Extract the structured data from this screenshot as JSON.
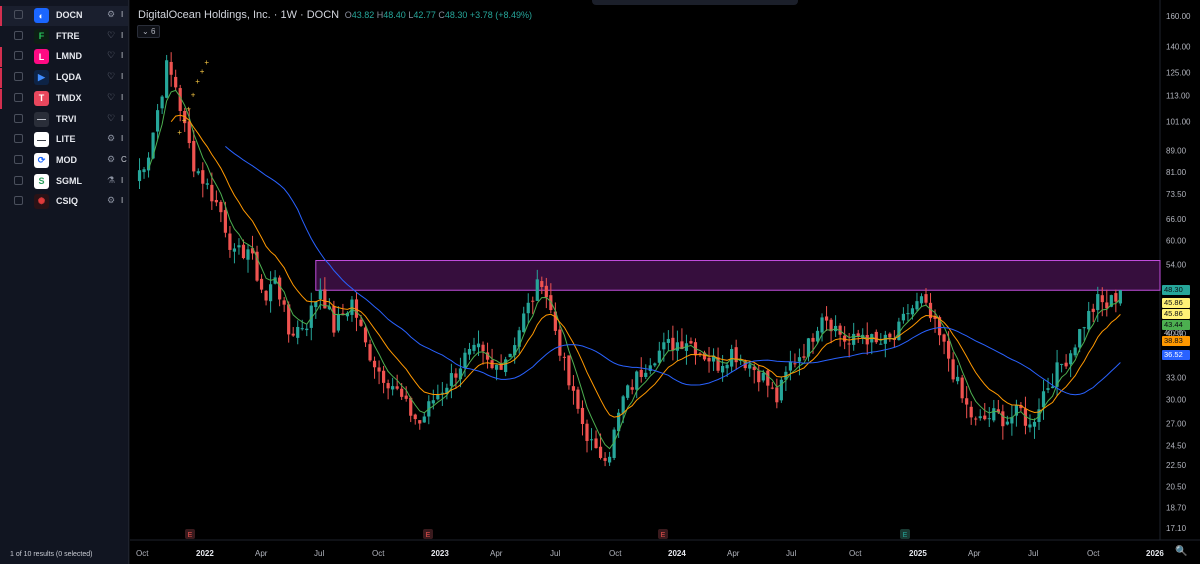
{
  "watchlist": {
    "items": [
      {
        "symbol": "DOCN",
        "flag": "#d32f4f",
        "logo_bg": "#1a66ff",
        "logo_glyph": "◐",
        "logo_color": "#ffffff",
        "action_icon": "settings-icon",
        "trunc": "I"
      },
      {
        "symbol": "FTRE",
        "flag": "",
        "logo_bg": "#0d1f14",
        "logo_glyph": "F",
        "logo_color": "#27c65d",
        "action_icon": "heart-icon",
        "trunc": "I"
      },
      {
        "symbol": "LMND",
        "flag": "#d32f4f",
        "logo_bg": "#ff0a83",
        "logo_glyph": "L",
        "logo_color": "#ffffff",
        "action_icon": "heart-icon",
        "trunc": "I"
      },
      {
        "symbol": "LQDA",
        "flag": "#d32f4f",
        "logo_bg": "#0d2345",
        "logo_glyph": "▶",
        "logo_color": "#3f8cff",
        "action_icon": "heart-icon",
        "trunc": "I"
      },
      {
        "symbol": "TMDX",
        "flag": "#d32f4f",
        "logo_bg": "#e8475d",
        "logo_glyph": "T",
        "logo_color": "#ffffff",
        "action_icon": "heart-icon",
        "trunc": "I"
      },
      {
        "symbol": "TRVI",
        "flag": "",
        "logo_bg": "#2a2e39",
        "logo_glyph": "—",
        "logo_color": "#c9ccd4",
        "action_icon": "heart-icon",
        "trunc": "I"
      },
      {
        "symbol": "LITE",
        "flag": "",
        "logo_bg": "#ffffff",
        "logo_glyph": "—",
        "logo_color": "#2a2e39",
        "action_icon": "settings-icon",
        "trunc": "I"
      },
      {
        "symbol": "MOD",
        "flag": "",
        "logo_bg": "#ffffff",
        "logo_glyph": "⟳",
        "logo_color": "#1a66ff",
        "action_icon": "settings-icon",
        "trunc": "C"
      },
      {
        "symbol": "SGML",
        "flag": "",
        "logo_bg": "#ffffff",
        "logo_glyph": "S",
        "logo_color": "#2a9d5a",
        "action_icon": "flask-icon",
        "trunc": "I"
      },
      {
        "symbol": "CSIQ",
        "flag": "",
        "logo_bg": "#2a1216",
        "logo_glyph": "✺",
        "logo_color": "#e03b3b",
        "action_icon": "settings-icon",
        "trunc": "I"
      }
    ],
    "footer": "1 of 10 results (0 selected)"
  },
  "legend": {
    "title": "DigitalOcean Holdings, Inc. · 1W · DOCN",
    "o_label": "O",
    "o": "43.82",
    "h_label": "H",
    "h": "48.40",
    "l_label": "L",
    "l": "42.77",
    "c_label": "C",
    "c": "48.30",
    "change": "+3.78 (+8.49%)",
    "indicator_toggle": "6"
  },
  "colors": {
    "up": "#26a69a",
    "down": "#ef5350",
    "ema_fast": "#4caf50",
    "ema_mid": "#ff9800",
    "sma": "#2962ff",
    "zone": "#9c27b0"
  },
  "chart_data": {
    "type": "candlestick",
    "title": "DigitalOcean Holdings, Inc. · 1W · DOCN",
    "y_scale": "log",
    "y_ticks": [
      "160.00",
      "140.00",
      "125.00",
      "113.00",
      "101.00",
      "89.00",
      "81.00",
      "73.50",
      "66.00",
      "60.00",
      "54.00",
      "48.30",
      "45.86",
      "45.86",
      "43.44",
      "40.00",
      "38.83",
      "36.52",
      "33.00",
      "30.00",
      "27.00",
      "24.50",
      "22.50",
      "20.50",
      "18.70",
      "17.10"
    ],
    "x_ticks": [
      "Oct",
      "2022",
      "Apr",
      "Jul",
      "Oct",
      "2023",
      "Apr",
      "Jul",
      "Oct",
      "2024",
      "Apr",
      "Jul",
      "Oct",
      "2025",
      "Apr",
      "Jul",
      "Oct",
      "2026"
    ],
    "zone": {
      "low": 48.3,
      "high": 55.0
    },
    "earnings_markers": [
      "E",
      "E",
      "E",
      "E"
    ],
    "last_values": {
      "close": "48.30",
      "ma1": "45.86",
      "ma2": "45.86",
      "ma3": "43.44",
      "ma4": "38.83",
      "ma5": "36.52"
    },
    "ylim": [
      17.1,
      160
    ],
    "anchors": [
      {
        "w": 0,
        "p": 78
      },
      {
        "w": 3,
        "p": 88
      },
      {
        "w": 5,
        "p": 106
      },
      {
        "w": 7,
        "p": 128
      },
      {
        "w": 9,
        "p": 118
      },
      {
        "w": 11,
        "p": 98
      },
      {
        "w": 13,
        "p": 84
      },
      {
        "w": 16,
        "p": 76
      },
      {
        "w": 19,
        "p": 68
      },
      {
        "w": 22,
        "p": 56
      },
      {
        "w": 25,
        "p": 58
      },
      {
        "w": 29,
        "p": 46
      },
      {
        "w": 31,
        "p": 52
      },
      {
        "w": 34,
        "p": 40
      },
      {
        "w": 38,
        "p": 42
      },
      {
        "w": 41,
        "p": 49
      },
      {
        "w": 44,
        "p": 41
      },
      {
        "w": 48,
        "p": 46
      },
      {
        "w": 51,
        "p": 38
      },
      {
        "w": 54,
        "p": 34
      },
      {
        "w": 57,
        "p": 32
      },
      {
        "w": 60,
        "p": 29
      },
      {
        "w": 63,
        "p": 27
      },
      {
        "w": 66,
        "p": 30
      },
      {
        "w": 70,
        "p": 33
      },
      {
        "w": 73,
        "p": 36
      },
      {
        "w": 76,
        "p": 37
      },
      {
        "w": 79,
        "p": 34
      },
      {
        "w": 83,
        "p": 37
      },
      {
        "w": 86,
        "p": 43
      },
      {
        "w": 90,
        "p": 51
      },
      {
        "w": 92,
        "p": 44
      },
      {
        "w": 96,
        "p": 32
      },
      {
        "w": 99,
        "p": 27
      },
      {
        "w": 102,
        "p": 23.5
      },
      {
        "w": 105,
        "p": 24
      },
      {
        "w": 108,
        "p": 30
      },
      {
        "w": 111,
        "p": 33
      },
      {
        "w": 114,
        "p": 36
      },
      {
        "w": 118,
        "p": 38
      },
      {
        "w": 122,
        "p": 39
      },
      {
        "w": 125,
        "p": 37
      },
      {
        "w": 129,
        "p": 35
      },
      {
        "w": 132,
        "p": 37
      },
      {
        "w": 136,
        "p": 35
      },
      {
        "w": 139,
        "p": 33
      },
      {
        "w": 142,
        "p": 30
      },
      {
        "w": 145,
        "p": 35
      },
      {
        "w": 149,
        "p": 38
      },
      {
        "w": 152,
        "p": 44
      },
      {
        "w": 155,
        "p": 41
      },
      {
        "w": 158,
        "p": 38
      },
      {
        "w": 161,
        "p": 40
      },
      {
        "w": 164,
        "p": 38
      },
      {
        "w": 168,
        "p": 39
      },
      {
        "w": 171,
        "p": 44
      },
      {
        "w": 174,
        "p": 46
      },
      {
        "w": 177,
        "p": 41
      },
      {
        "w": 180,
        "p": 36
      },
      {
        "w": 183,
        "p": 30
      },
      {
        "w": 186,
        "p": 27
      },
      {
        "w": 190,
        "p": 28
      },
      {
        "w": 193,
        "p": 27.5
      },
      {
        "w": 196,
        "p": 28.5
      },
      {
        "w": 198,
        "p": 26.5
      },
      {
        "w": 201,
        "p": 31
      },
      {
        "w": 204,
        "p": 34
      },
      {
        "w": 207,
        "p": 37
      },
      {
        "w": 210,
        "p": 42
      },
      {
        "w": 213,
        "p": 46
      },
      {
        "w": 215,
        "p": 45
      },
      {
        "w": 218,
        "p": 48.3
      }
    ]
  }
}
